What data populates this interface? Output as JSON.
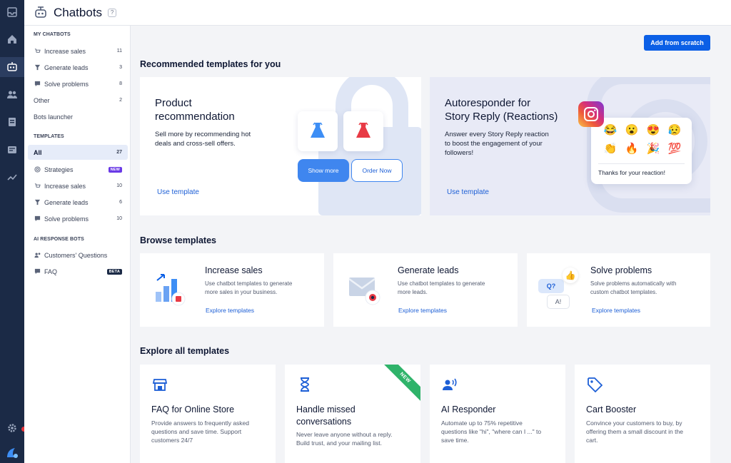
{
  "header": {
    "title": "Chatbots",
    "help": "?"
  },
  "sidebar": {
    "my_chatbots": {
      "title": "MY CHATBOTS",
      "items": [
        {
          "label": "Increase sales",
          "count": "11"
        },
        {
          "label": "Generate leads",
          "count": "3"
        },
        {
          "label": "Solve problems",
          "count": "8"
        },
        {
          "label": "Other",
          "count": "2"
        },
        {
          "label": "Bots launcher",
          "count": ""
        }
      ]
    },
    "templates": {
      "title": "TEMPLATES",
      "items": [
        {
          "label": "All",
          "count": "27"
        },
        {
          "label": "Strategies",
          "badge": "NEW"
        },
        {
          "label": "Increase sales",
          "count": "10"
        },
        {
          "label": "Generate leads",
          "count": "6"
        },
        {
          "label": "Solve problems",
          "count": "10"
        }
      ]
    },
    "ai_bots": {
      "title": "AI RESPONSE BOTS",
      "items": [
        {
          "label": "Customers' Questions"
        },
        {
          "label": "FAQ",
          "badge": "BETA"
        }
      ]
    }
  },
  "main": {
    "add_button": "Add from scratch",
    "recommended": {
      "title": "Recommended templates for you",
      "cards": [
        {
          "title_line1": "Product",
          "title_line2": "recommendation",
          "desc_line1": "Sell more by recommending hot",
          "desc_line2": "deals and cross-sell offers.",
          "link": "Use template",
          "show_more": "Show more",
          "order_now": "Order Now"
        },
        {
          "title_line1": "Autoresponder for",
          "title_line2": "Story Reply (Reactions)",
          "desc_line1": "Answer every Story Reply reaction",
          "desc_line2": "to boost the engagement of your",
          "desc_line3": "followers!",
          "link": "Use template",
          "emojis": [
            "😂",
            "😮",
            "😍",
            "😥",
            "👏",
            "🔥",
            "🎉",
            "💯"
          ],
          "reaction_text": "Thanks for your reaction!"
        }
      ]
    },
    "browse": {
      "title": "Browse templates",
      "cards": [
        {
          "title": "Increase sales",
          "desc_line1": "Use chatbot templates to generate",
          "desc_line2": "more sales in your business.",
          "link": "Explore templates"
        },
        {
          "title": "Generate leads",
          "desc_line1": "Use chatbot templates to generate",
          "desc_line2": "more leads.",
          "link": "Explore templates"
        },
        {
          "title": "Solve problems",
          "desc_line1": "Solve problems automatically with",
          "desc_line2": "custom chatbot templates.",
          "link": "Explore templates",
          "bubble_q": "Q?",
          "bubble_a": "A!"
        }
      ]
    },
    "explore": {
      "title": "Explore all templates",
      "cards": [
        {
          "title_line1": "FAQ for Online Store",
          "title_line2": "",
          "desc_line1": "Provide answers to frequently asked",
          "desc_line2": "questions and save time. Support",
          "desc_line3": "customers 24/7"
        },
        {
          "title_line1": "Handle missed",
          "title_line2": "conversations",
          "desc_line1": "Never leave anyone without a reply.",
          "desc_line2": "Build trust, and your mailing list.",
          "desc_line3": "",
          "ribbon": "NEW"
        },
        {
          "title_line1": "AI Responder",
          "title_line2": "",
          "desc_line1": "Automate up to 75% repetitive",
          "desc_line2": "questions like \"hi\", \"where can I ...\" to",
          "desc_line3": "save time."
        },
        {
          "title_line1": "Cart Booster",
          "title_line2": "",
          "desc_line1": "Convince your customers to buy, by",
          "desc_line2": "offering them a small discount in the",
          "desc_line3": "cart."
        }
      ]
    }
  },
  "colors": {
    "primary": "#0b5fe6",
    "link": "#1d5fd6",
    "rail": "#1b2a46",
    "new_badge": "#6a3ae6",
    "ribbon": "#2fb36a"
  }
}
